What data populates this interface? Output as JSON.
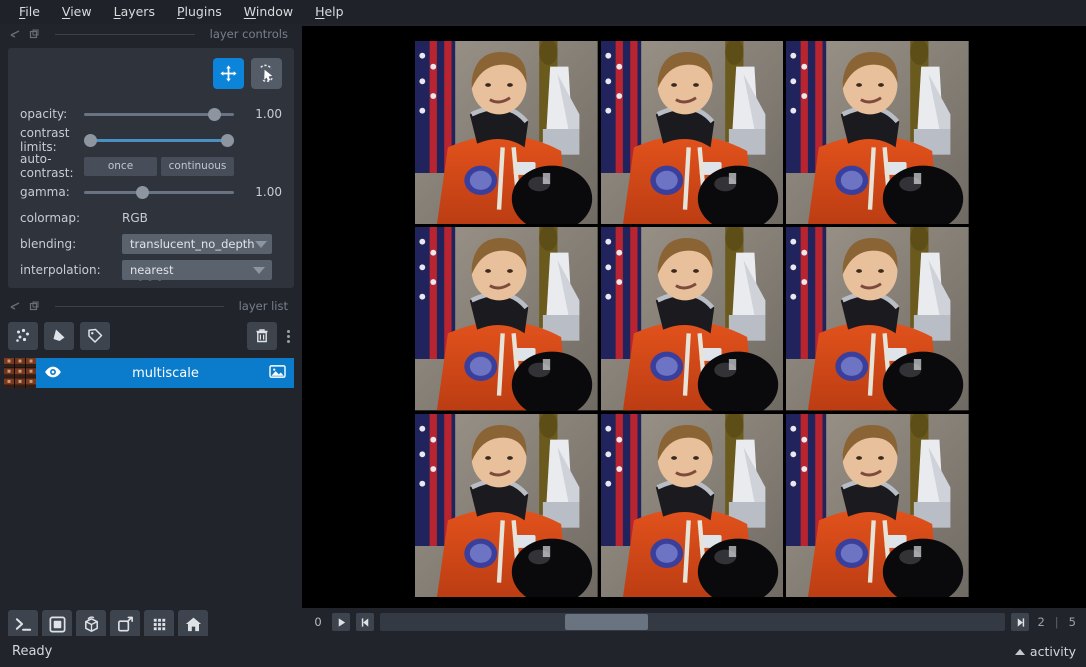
{
  "menubar": {
    "items": [
      {
        "label": "File",
        "mnemonic": "F"
      },
      {
        "label": "View",
        "mnemonic": "V"
      },
      {
        "label": "Layers",
        "mnemonic": "L"
      },
      {
        "label": "Plugins",
        "mnemonic": "P"
      },
      {
        "label": "Window",
        "mnemonic": "W"
      },
      {
        "label": "Help",
        "mnemonic": "H"
      }
    ]
  },
  "layer_controls": {
    "title": "layer controls",
    "modes": [
      {
        "name": "pan-zoom",
        "active": true
      },
      {
        "name": "transform",
        "active": false
      }
    ],
    "opacity": {
      "label": "opacity:",
      "value": "1.00",
      "fill_percent": 100
    },
    "contrast_limits": {
      "label": "contrast limits:",
      "low_percent": 0,
      "high_percent": 100
    },
    "auto_contrast": {
      "label": "auto-contrast:",
      "once": "once",
      "continuous": "continuous"
    },
    "gamma": {
      "label": "gamma:",
      "value": "1.00",
      "fill_percent": 50
    },
    "colormap": {
      "label": "colormap:",
      "value": "RGB"
    },
    "blending": {
      "label": "blending:",
      "value": "translucent_no_depth"
    },
    "interpolation": {
      "label": "interpolation:",
      "value": "nearest"
    }
  },
  "layer_list": {
    "title": "layer list",
    "tools": [
      "new-points-layer",
      "new-shapes-layer",
      "new-labels-layer"
    ],
    "delete": "delete-layer",
    "layers": [
      {
        "name": "multiscale",
        "visible": true,
        "type": "image",
        "selected": true
      }
    ]
  },
  "viewer_buttons": [
    {
      "name": "console-button"
    },
    {
      "name": "ndisplay-toggle-button"
    },
    {
      "name": "roll-dims-button"
    },
    {
      "name": "transpose-dims-button"
    },
    {
      "name": "grid-view-button"
    },
    {
      "name": "home-reset-button"
    }
  ],
  "canvas": {
    "background": "#000000",
    "grid": {
      "rows": 3,
      "cols": 3,
      "tiles": 9
    },
    "image_alt": "astronaut portrait in orange launch suit with US flag and shuttle model"
  },
  "dims": {
    "axis_label": "0",
    "play_button": "play-button",
    "step_button": "step-to-start-button",
    "forward_button": "step-to-end-button",
    "current": "2",
    "separator": "|",
    "total": "5"
  },
  "statusbar": {
    "message": "Ready",
    "activity_label": "activity"
  },
  "colors": {
    "accent": "#0b84d9",
    "layer_selected": "#0b7ccc",
    "panel": "#21252b",
    "box": "#2e333c",
    "slider_active": "#4a90c4"
  }
}
